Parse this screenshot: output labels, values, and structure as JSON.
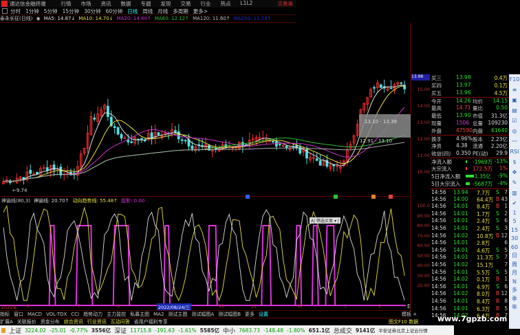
{
  "menu": {
    "app_title": "通达信金融终端",
    "items": [
      "行情",
      "市场",
      "资讯",
      "数据",
      "专题",
      "发现",
      "交易",
      "行业",
      "热点",
      "L1L2"
    ],
    "trade": "交易串"
  },
  "periods": [
    "分时",
    "1分钟",
    "5分钟",
    "15分钟",
    "30分钟",
    "60分钟",
    "日线",
    "周线",
    "月线",
    "多周期",
    "更多>"
  ],
  "active_period": "日线",
  "ma_legend": {
    "stock": "泰永长征(日线)",
    "items": [
      {
        "t": "MA5: 14.87↓",
        "c": "#e0e0e0"
      },
      {
        "t": "MA10: 14.70↓",
        "c": "#e8e040"
      },
      {
        "t": "MA20: 14.60↑",
        "c": "#d030d0"
      },
      {
        "t": "MA60: 12.12↑",
        "c": "#30c030"
      },
      {
        "t": "MA120: 11.60↑",
        "c": "#c0c0c0"
      },
      {
        "t": "MA250: 11.23↑",
        "c": "#2030c0"
      }
    ]
  },
  "price_axis": [
    "15.00",
    "14.00",
    "13.00",
    "12.00",
    "11.00",
    "10.00"
  ],
  "low_marker": "9.74",
  "range_labels": [
    "13.10 - 13.38",
    "12.91 - 13.10"
  ],
  "kline_keypoints": [
    [
      0,
      10.1
    ],
    [
      10,
      10.5
    ],
    [
      14,
      10.8
    ],
    [
      18,
      10.4
    ],
    [
      22,
      10.6
    ],
    [
      26,
      12.8
    ],
    [
      30,
      13.4
    ],
    [
      33,
      12.3
    ],
    [
      37,
      11.9
    ],
    [
      44,
      12.1
    ],
    [
      50,
      12.3
    ],
    [
      56,
      11.7
    ],
    [
      62,
      11.5
    ],
    [
      68,
      11.7
    ],
    [
      76,
      11.9
    ],
    [
      82,
      11.8
    ],
    [
      90,
      11.3
    ],
    [
      97,
      10.7
    ],
    [
      101,
      10.9
    ],
    [
      106,
      13.2
    ],
    [
      110,
      14.3
    ],
    [
      114,
      14.4
    ],
    [
      119,
      14.3
    ]
  ],
  "indicator": {
    "legend": "神谕线(80,3)",
    "l1": "神谕线: 20.70↑",
    "l2": "动向趋势线: 55.48↑",
    "l3": "捉影: 0.00",
    "axis": [
      "100.0",
      "90.00",
      "80.00",
      "70.00",
      "60.00",
      "50.00",
      "40.00",
      "30.00",
      "20.00"
    ],
    "pulses": [
      [
        14,
        15
      ],
      [
        22,
        26
      ],
      [
        33,
        37
      ],
      [
        48,
        49
      ],
      [
        61,
        63
      ],
      [
        77,
        79
      ],
      [
        87,
        88
      ],
      [
        92,
        93
      ],
      [
        96,
        98
      ]
    ],
    "popup": "A| 筛选买卖 ▾ |"
  },
  "xaxis": [
    {
      "t": "2022年",
      "hl": false
    },
    {
      "t": "6"
    },
    {
      "t": "7"
    },
    {
      "t": "8"
    },
    {
      "t": "2022/08/24/三",
      "hl": true
    },
    {
      "t": "10"
    },
    {
      "t": "11"
    },
    {
      "t": "12"
    },
    {
      "t": "1"
    },
    {
      "t": "2"
    }
  ],
  "tabs1": [
    "指标",
    "窗口",
    "MACD",
    "VOL-TDX",
    "CCI",
    "趋势动力",
    "主力监控",
    "私募主图",
    "MA2",
    "测试主图",
    "测试幅图A",
    "测试幅图B",
    "更多",
    "设置"
  ],
  "tabs1_right": "模板 +",
  "tabs2": [
    "扩展A",
    "关联报价",
    "资金分布",
    "综合资讯",
    "行业资讯",
    "互动问答",
    "省用户福利专享"
  ],
  "tabs2_right": "图文F10 数据",
  "quote": {
    "bids": [
      [
        "买三",
        "13.98",
        "0.4万"
      ],
      [
        "买四",
        "13.97",
        "0.1万"
      ],
      [
        "买五",
        "13.96",
        "4.5万"
      ]
    ],
    "stats": [
      [
        "今开",
        "14.26",
        "均价",
        "14.15"
      ],
      [
        "最高",
        "14.71",
        "量比",
        "0.50"
      ],
      [
        "最低",
        "13.90",
        "市值",
        "31.3亿"
      ],
      [
        "现量",
        "1506",
        "总量",
        "109230"
      ],
      [
        "外盘",
        "47590",
        "内盘",
        "61640"
      ],
      [
        "换手",
        "4.96%",
        "股本",
        "2.23亿"
      ],
      [
        "净资",
        "4.38",
        "流通",
        "2.20亿"
      ],
      [
        "收益(四)",
        "0.350",
        "PE(动)",
        "29.9"
      ]
    ],
    "flows": [
      [
        "净流入额",
        "-1969万",
        "-13%"
      ],
      [
        "大宗流入",
        "172.5万",
        "1%"
      ],
      [
        "5日净流入额",
        "-1.35亿",
        "-9%"
      ],
      [
        "5日大宗流入",
        "-5687万",
        "-4%"
      ]
    ]
  },
  "trades": [
    [
      "14:56",
      "13.94",
      "7.7万",
      "S",
      "7"
    ],
    [
      "14:56",
      "14.00",
      "64.4万",
      "B",
      "43"
    ],
    [
      "14:56",
      "14.01",
      "8.4万",
      "B",
      "1"
    ],
    [
      "14:56",
      "14.01",
      "1.7万",
      "S",
      "2"
    ],
    [
      "14:56",
      "14.01",
      "2.4万",
      "S",
      "6"
    ],
    [
      "14:56",
      "14.01",
      "2.4万",
      "S",
      "3"
    ],
    [
      "14:56",
      "14.02",
      "10.8万",
      "B",
      "12"
    ],
    [
      "14:56",
      "14.01",
      "2.8万",
      "",
      "6"
    ],
    [
      "14:56",
      "14.01",
      "4.6万",
      "S",
      "5"
    ],
    [
      "14:56",
      "14.01",
      "11.3万",
      "S",
      "7"
    ],
    [
      "14:56",
      "14.02",
      "15.1万",
      "",
      "7"
    ],
    [
      "14:56",
      "14.01",
      "5.5万",
      "S",
      "5"
    ],
    [
      "14:56",
      "14.02",
      "0.1万",
      "B",
      "1"
    ],
    [
      "14:56",
      "14.01",
      "4.9万",
      "S",
      "6"
    ],
    [
      "14:56",
      "14.02",
      "8.0万",
      "B",
      "12"
    ],
    [
      "14:56",
      "14.01",
      "8.4万",
      "B",
      "8"
    ],
    [
      "14:56",
      "14.01",
      "6.3万",
      "B",
      "5"
    ],
    [
      "14:56",
      "14.02",
      "6.4万",
      "B",
      "7"
    ]
  ],
  "side_icons": [
    "F10",
    "≡",
    "▣",
    "▤",
    "☑",
    "◎",
    "〰",
    "RSI",
    "$",
    "✥",
    "✎",
    "▥",
    "✔",
    "1",
    "5",
    "15",
    "30",
    "60",
    "日",
    "周",
    "月",
    "N",
    "多",
    "季",
    "年"
  ],
  "status": [
    {
      "n": "上证",
      "v": "3224.02",
      "c": "-25.01",
      "p": "-0.77%",
      "a": "3556亿"
    },
    {
      "n": "深证",
      "v": "11715.8",
      "c": "-191.63",
      "p": "-1.61%",
      "a": "5585亿"
    },
    {
      "n": "中小",
      "v": "7683.73",
      "c": "-148.48",
      "p": "-1.80%",
      "a": "651.1亿"
    }
  ],
  "total_label": "总成交",
  "total": "9141亿",
  "source": "平安证券北京上证云行情",
  "watermark": "www.7gpzb.com"
}
